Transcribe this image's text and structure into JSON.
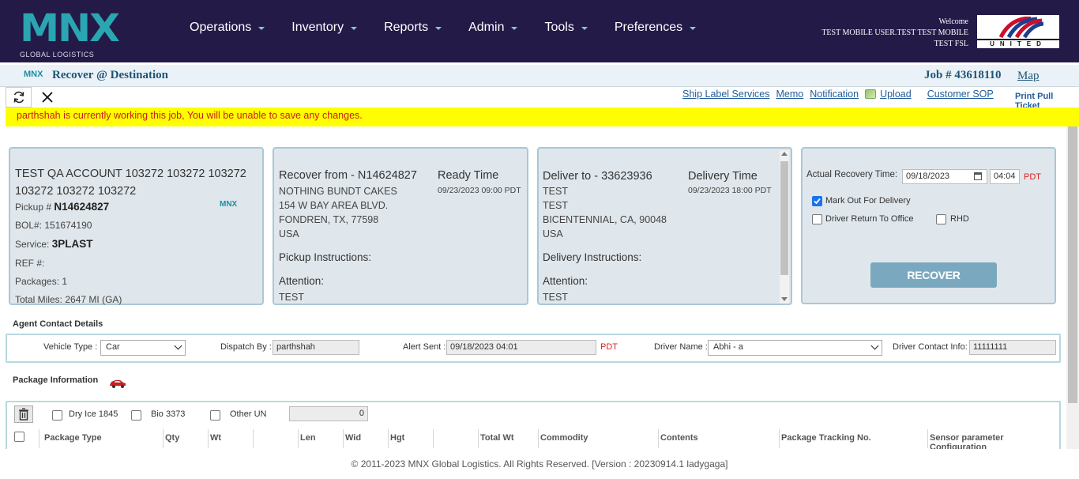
{
  "header": {
    "logo_text": "MNX",
    "logo_sub": "GLOBAL LOGISTICS",
    "nav": [
      "Operations",
      "Inventory",
      "Reports",
      "Admin",
      "Tools",
      "Preferences"
    ],
    "welcome_label": "Welcome",
    "user_line1": "TEST MOBILE USER.TEST TEST MOBILE",
    "user_line2": "TEST FSL",
    "partner_logo_text": "UNITED"
  },
  "titlebar": {
    "badge": "MNX",
    "title": "Recover @ Destination",
    "job": "Job # 43618110",
    "map": "Map"
  },
  "toolbar": {
    "links": [
      "Ship Label Services",
      "Memo",
      "Notification",
      "Upload",
      "Customer SOP"
    ],
    "print_pull_ticket": "Print Pull Ticket"
  },
  "warning": "parthshah is currently working this job, You will be unable to save any changes.",
  "account": {
    "name": "TEST QA ACCOUNT 103272 103272 103272 103272 103272 103272",
    "pickup_label": "Pickup #",
    "pickup_value": "N14624827",
    "bol_label": "BOL#:",
    "bol_value": "151674190",
    "service_label": "Service:",
    "service_value": "3PLAST",
    "ref_label": "REF #:",
    "packages_label": "Packages:",
    "packages_value": "1",
    "miles_label": "Total Miles:",
    "miles_value": "2647  MI  (GA)",
    "badge": "MNX"
  },
  "recover_from": {
    "heading": "Recover from - N14624827",
    "time_label": "Ready Time",
    "time_value": "09/23/2023 09:00 PDT",
    "line1": "NOTHING BUNDT CAKES",
    "line2": "154 W BAY AREA BLVD.",
    "line3": "FONDREN, TX, 77598",
    "line4": "USA",
    "instructions": "Pickup Instructions:",
    "attention": "Attention:",
    "attention_value": "TEST"
  },
  "deliver_to": {
    "heading": "Deliver to - 33623936",
    "time_label": "Delivery Time",
    "time_value": "09/23/2023 18:00 PDT",
    "line1": "TEST",
    "line2": "TEST",
    "line3": "BICENTENNIAL, CA, 90048",
    "line4": "USA",
    "instructions": "Delivery Instructions:",
    "attention": "Attention:",
    "attention_value": "TEST"
  },
  "recovery": {
    "time_label": "Actual Recovery Time:",
    "date": "09/18/2023",
    "time": "04:04",
    "tz": "PDT",
    "mark_out": "Mark Out For Delivery",
    "mark_out_checked": true,
    "driver_return": "Driver Return To Office",
    "rhd": "RHD",
    "button": "RECOVER"
  },
  "agent": {
    "title": "Agent Contact Details",
    "vehicle_label": "Vehicle Type :",
    "vehicle_value": "Car",
    "dispatch_label": "Dispatch By :",
    "dispatch_value": "parthshah",
    "alert_label": "Alert Sent :",
    "alert_value": "09/18/2023 04:01",
    "alert_tz": "PDT",
    "driver_label": "Driver Name :",
    "driver_value": "Abhi - a",
    "contact_label": "Driver Contact Info:",
    "contact_value": "11111111"
  },
  "package": {
    "title": "Package Information",
    "dry_ice": "Dry Ice 1845",
    "bio": "Bio 3373",
    "other_un": "Other UN",
    "un_value": "0",
    "columns": [
      "Package Type",
      "Qty",
      "Wt",
      "",
      "Len",
      "Wid",
      "Hgt",
      "",
      "Total Wt",
      "Commodity",
      "Contents",
      "Package Tracking No.",
      "Sensor parameter Configuration"
    ]
  },
  "footer": "© 2011-2023 MNX Global Logistics. All Rights Reserved. [Version : 20230914.1 ladygaga]",
  "colors": {
    "topbar": "#241a48",
    "brand": "#2aa5b2",
    "warning_bg": "#fffe00",
    "warning_text": "#cc1b1b",
    "card_bg": "#e0e7ec",
    "button": "#7aa9bf"
  }
}
